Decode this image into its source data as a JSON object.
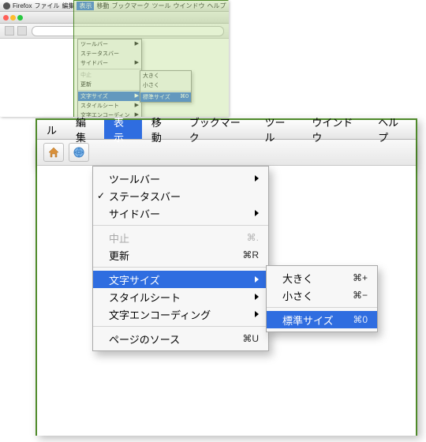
{
  "app_name": "Firefox",
  "menubar": {
    "items": [
      {
        "label": "ル"
      },
      {
        "label": "編集"
      },
      {
        "label": "表示",
        "selected": true
      },
      {
        "label": "移動"
      },
      {
        "label": "ブックマーク"
      },
      {
        "label": "ツール"
      },
      {
        "label": "ウインドウ"
      },
      {
        "label": "ヘルプ"
      }
    ]
  },
  "thumb_menubar": {
    "items": [
      "ファイル",
      "編集",
      "表示",
      "移動",
      "ブックマーク",
      "ツール",
      "ウインドウ",
      "ヘルプ"
    ]
  },
  "view_menu": {
    "group1": [
      {
        "label": "ツールバー",
        "submenu": true
      },
      {
        "label": "ステータスバー",
        "checked": true
      },
      {
        "label": "サイドバー",
        "submenu": true
      }
    ],
    "group2": [
      {
        "label": "中止",
        "shortcut": "⌘.",
        "disabled": true
      },
      {
        "label": "更新",
        "shortcut": "⌘R"
      }
    ],
    "group3": [
      {
        "label": "文字サイズ",
        "submenu": true,
        "selected": true
      },
      {
        "label": "スタイルシート",
        "submenu": true
      },
      {
        "label": "文字エンコーディング",
        "submenu": true
      }
    ],
    "group4": [
      {
        "label": "ページのソース",
        "shortcut": "⌘U"
      }
    ]
  },
  "text_size_submenu": {
    "items": [
      {
        "label": "大きく",
        "shortcut": "⌘+"
      },
      {
        "label": "小さく",
        "shortcut": "⌘−"
      }
    ],
    "reset": {
      "label": "標準サイズ",
      "shortcut": "⌘0",
      "selected": true
    }
  }
}
